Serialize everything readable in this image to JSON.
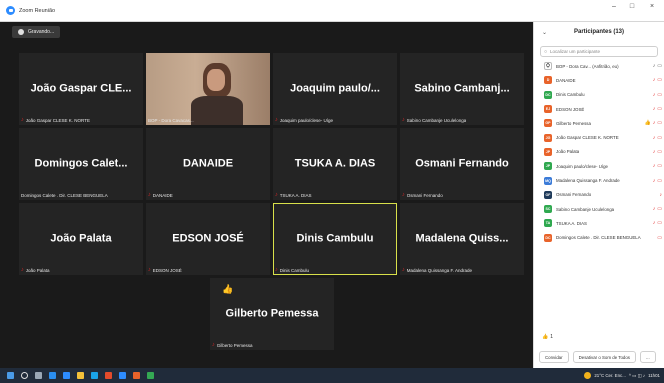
{
  "window": {
    "title": "Zoom Reunião",
    "minimize": "–",
    "maximize": "□",
    "close": "×"
  },
  "recording": {
    "label": "Gravando..."
  },
  "tiles": [
    {
      "big": "João Gaspar CLE...",
      "label": "João Gaspar CLESE K. NORTE",
      "muted": true
    },
    {
      "big": "",
      "label": "BOP - Dora Cavacas...",
      "muted": false,
      "video": true
    },
    {
      "big": "Joaquim  paulo/...",
      "label": "Joaquim  paulo/clese- Uíge",
      "muted": true
    },
    {
      "big": "Sabino Cambanj...",
      "label": "Sabino Cambanje Uculelonga",
      "muted": true
    },
    {
      "big": "Domingos Calet...",
      "label": "Domingos Calete . Dir. CLESE BENGUELA",
      "muted": false
    },
    {
      "big": "DANAIDE",
      "label": "DANAIDE",
      "muted": true
    },
    {
      "big": "TSUKA A. DIAS",
      "label": "TSUKA A. DIAS",
      "muted": true
    },
    {
      "big": "Osmani Fernando",
      "label": "Osmani Fernando",
      "muted": true
    },
    {
      "big": "João Palata",
      "label": "João Palata",
      "muted": true
    },
    {
      "big": "EDSON JOSÉ",
      "label": "EDSON JOSÉ",
      "muted": true
    },
    {
      "big": "Dinis Cambulu",
      "label": "Dinis Cambulu",
      "muted": true,
      "active": true
    },
    {
      "big": "Madalena  Quiss...",
      "label": "Madalena Quissanga  F. Andrade",
      "muted": true
    },
    {
      "big": "Gilberto Pemessa",
      "label": "Gilberto Pemessa",
      "muted": true,
      "reaction": "👍"
    }
  ],
  "panel": {
    "title": "Participantes (13)",
    "search_placeholder": "Localizar um participante",
    "participants": [
      {
        "initials": "",
        "name": "BOP - Dora Cav... (Anfitrião, eu)",
        "color": "#ffffff",
        "host": true
      },
      {
        "initials": "D",
        "name": "DANAIDE",
        "color": "#e8632a"
      },
      {
        "initials": "DC",
        "name": "Dinis Cambulu",
        "color": "#2fa84f"
      },
      {
        "initials": "EJ",
        "name": "EDSON JOSÉ",
        "color": "#e8632a"
      },
      {
        "initials": "GP",
        "name": "Gilberto Pemessa",
        "color": "#e8632a",
        "reaction": "👍"
      },
      {
        "initials": "JG",
        "name": "João Gaspar CLESE K. NORTE",
        "color": "#e8632a"
      },
      {
        "initials": "JP",
        "name": "João Palata",
        "color": "#e8632a"
      },
      {
        "initials": "JP",
        "name": "Joaquim  paulo/clese- Uíge",
        "color": "#2fa84f"
      },
      {
        "initials": "MQ",
        "name": "Madalena Quissanga  F. Andrade",
        "color": "#3b7bd8"
      },
      {
        "initials": "OF",
        "name": "Osmani Fernando",
        "color": "#1f3a5a"
      },
      {
        "initials": "SC",
        "name": "Sabino Cambanje Uculelonga",
        "color": "#2fa84f"
      },
      {
        "initials": "TA",
        "name": "TSUKA A. DIAS",
        "color": "#2fa84f"
      },
      {
        "initials": "DC",
        "name": "Domingos Calete . Dir. CLESE BENGUELA",
        "color": "#e8632a"
      }
    ],
    "reaction_count": "1",
    "invite_label": "Convidar",
    "mute_all_label": "Desativar o Som de Todos",
    "more_label": "..."
  },
  "taskbar": {
    "weather": "21°C  Cer. Enc...",
    "time": "11h01"
  }
}
